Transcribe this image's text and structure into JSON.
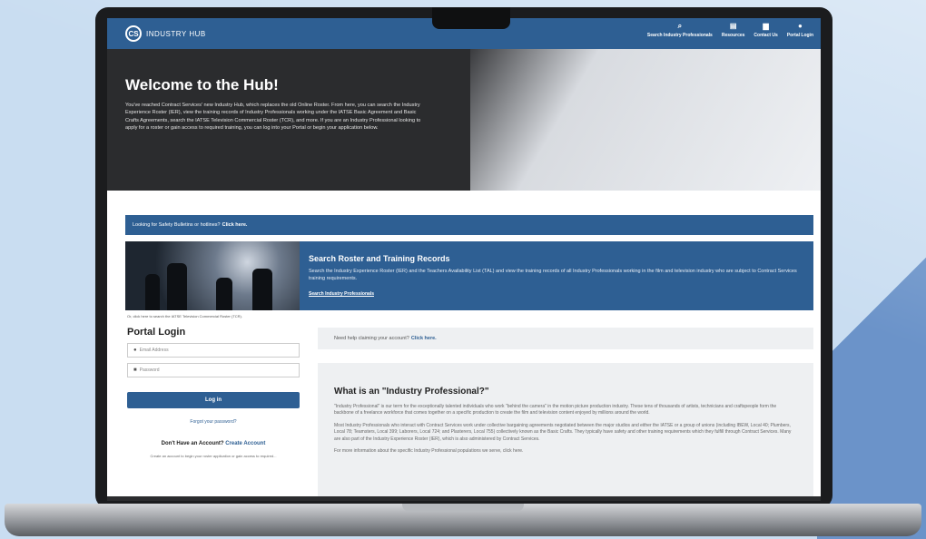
{
  "nav": {
    "logo_mark": "CS",
    "logo_text": "INDUSTRY HUB",
    "links": [
      {
        "icon": "search-icon",
        "glyph": "⌕",
        "label": "Search Industry Professionals"
      },
      {
        "icon": "resources-icon",
        "glyph": "▤",
        "label": "Resources"
      },
      {
        "icon": "chat-icon",
        "glyph": "▆",
        "label": "Contact Us"
      },
      {
        "icon": "user-icon",
        "glyph": "●",
        "label": "Portal Login"
      }
    ]
  },
  "hero": {
    "title": "Welcome to the Hub!",
    "body": "You've reached Contract Services' new Industry Hub, which replaces the old Online Roster. From here, you can search the Industry Experience Roster (IER), view the training records of Industry Professionals working under the IATSE Basic Agreement and Basic Crafts Agreements, search the IATSE Television Commercial Roster (TCR), and more. If you are an Industry Professional looking to apply for a roster or gain access to required training, you can log into your Portal or begin your application below."
  },
  "safety": {
    "text": "Looking for Safety Bulletins or hotlines?",
    "link": "Click here."
  },
  "search_banner": {
    "title": "Search Roster and Training Records",
    "body": "Search the Industry Experience Roster (IER) and the Teachers Availability List (TAL) and view the training records of all Industry Professionals working in the film and television industry who are subject to Contract Services training requirements.",
    "link": "Search Industry Professionals",
    "tcr_note": "Or, click here to search the IATSE Television Commercial Roster (TCR)."
  },
  "portal": {
    "title": "Portal Login",
    "email_placeholder": "Email Address",
    "password_placeholder": "Password",
    "login_label": "Log in",
    "forgot_label": "Forgot your password?",
    "no_account_text": "Don't Have an Account?",
    "create_link": "Create Account",
    "create_note": "Create an account to begin your roster application or gain access to required..."
  },
  "claim": {
    "text": "Need help claiming your account?",
    "link": "Click here."
  },
  "industry_professional": {
    "title": "What is an \"Industry Professional?\"",
    "paragraphs": [
      "\"Industry Professional\" is our term for the exceptionally talented individuals who work \"behind the camera\" in the motion picture production industry. These tens of thousands of artists, technicians and craftspeople form the backbone of a freelance workforce that comes together on a specific production to create the film and television content enjoyed by millions around the world.",
      "Most Industry Professionals who interact with Contract Services work under collective bargaining agreements negotiated between the major studios and either the IATSE or a group of unions (including IBEW, Local 40; Plumbers, Local 78; Teamsters, Local 399; Laborers, Local 724; and Plasterers, Local 755) collectively known as the Basic Crafts. They typically have safety and other training requirements which they fulfill through Contract Services. Many are also part of the Industry Experience Roster (IER), which is also administered by Contract Services.",
      "For more information about the specific Industry Professional populations we serve, click here."
    ]
  },
  "colors": {
    "brand_blue": "#2e5f93",
    "hero_dark": "#2b2c2e",
    "background": "#c9ddf1"
  }
}
